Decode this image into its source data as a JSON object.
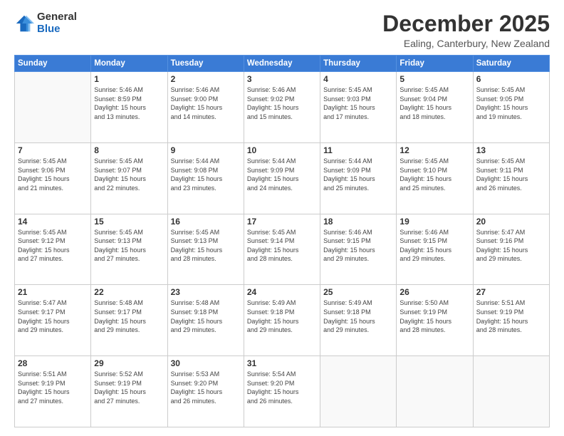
{
  "logo": {
    "general": "General",
    "blue": "Blue"
  },
  "header": {
    "month": "December 2025",
    "location": "Ealing, Canterbury, New Zealand"
  },
  "weekdays": [
    "Sunday",
    "Monday",
    "Tuesday",
    "Wednesday",
    "Thursday",
    "Friday",
    "Saturday"
  ],
  "weeks": [
    [
      {
        "day": "",
        "info": ""
      },
      {
        "day": "1",
        "info": "Sunrise: 5:46 AM\nSunset: 8:59 PM\nDaylight: 15 hours\nand 13 minutes."
      },
      {
        "day": "2",
        "info": "Sunrise: 5:46 AM\nSunset: 9:00 PM\nDaylight: 15 hours\nand 14 minutes."
      },
      {
        "day": "3",
        "info": "Sunrise: 5:46 AM\nSunset: 9:02 PM\nDaylight: 15 hours\nand 15 minutes."
      },
      {
        "day": "4",
        "info": "Sunrise: 5:45 AM\nSunset: 9:03 PM\nDaylight: 15 hours\nand 17 minutes."
      },
      {
        "day": "5",
        "info": "Sunrise: 5:45 AM\nSunset: 9:04 PM\nDaylight: 15 hours\nand 18 minutes."
      },
      {
        "day": "6",
        "info": "Sunrise: 5:45 AM\nSunset: 9:05 PM\nDaylight: 15 hours\nand 19 minutes."
      }
    ],
    [
      {
        "day": "7",
        "info": "Sunrise: 5:45 AM\nSunset: 9:06 PM\nDaylight: 15 hours\nand 21 minutes."
      },
      {
        "day": "8",
        "info": "Sunrise: 5:45 AM\nSunset: 9:07 PM\nDaylight: 15 hours\nand 22 minutes."
      },
      {
        "day": "9",
        "info": "Sunrise: 5:44 AM\nSunset: 9:08 PM\nDaylight: 15 hours\nand 23 minutes."
      },
      {
        "day": "10",
        "info": "Sunrise: 5:44 AM\nSunset: 9:09 PM\nDaylight: 15 hours\nand 24 minutes."
      },
      {
        "day": "11",
        "info": "Sunrise: 5:44 AM\nSunset: 9:09 PM\nDaylight: 15 hours\nand 25 minutes."
      },
      {
        "day": "12",
        "info": "Sunrise: 5:45 AM\nSunset: 9:10 PM\nDaylight: 15 hours\nand 25 minutes."
      },
      {
        "day": "13",
        "info": "Sunrise: 5:45 AM\nSunset: 9:11 PM\nDaylight: 15 hours\nand 26 minutes."
      }
    ],
    [
      {
        "day": "14",
        "info": "Sunrise: 5:45 AM\nSunset: 9:12 PM\nDaylight: 15 hours\nand 27 minutes."
      },
      {
        "day": "15",
        "info": "Sunrise: 5:45 AM\nSunset: 9:13 PM\nDaylight: 15 hours\nand 27 minutes."
      },
      {
        "day": "16",
        "info": "Sunrise: 5:45 AM\nSunset: 9:13 PM\nDaylight: 15 hours\nand 28 minutes."
      },
      {
        "day": "17",
        "info": "Sunrise: 5:45 AM\nSunset: 9:14 PM\nDaylight: 15 hours\nand 28 minutes."
      },
      {
        "day": "18",
        "info": "Sunrise: 5:46 AM\nSunset: 9:15 PM\nDaylight: 15 hours\nand 29 minutes."
      },
      {
        "day": "19",
        "info": "Sunrise: 5:46 AM\nSunset: 9:15 PM\nDaylight: 15 hours\nand 29 minutes."
      },
      {
        "day": "20",
        "info": "Sunrise: 5:47 AM\nSunset: 9:16 PM\nDaylight: 15 hours\nand 29 minutes."
      }
    ],
    [
      {
        "day": "21",
        "info": "Sunrise: 5:47 AM\nSunset: 9:17 PM\nDaylight: 15 hours\nand 29 minutes."
      },
      {
        "day": "22",
        "info": "Sunrise: 5:48 AM\nSunset: 9:17 PM\nDaylight: 15 hours\nand 29 minutes."
      },
      {
        "day": "23",
        "info": "Sunrise: 5:48 AM\nSunset: 9:18 PM\nDaylight: 15 hours\nand 29 minutes."
      },
      {
        "day": "24",
        "info": "Sunrise: 5:49 AM\nSunset: 9:18 PM\nDaylight: 15 hours\nand 29 minutes."
      },
      {
        "day": "25",
        "info": "Sunrise: 5:49 AM\nSunset: 9:18 PM\nDaylight: 15 hours\nand 29 minutes."
      },
      {
        "day": "26",
        "info": "Sunrise: 5:50 AM\nSunset: 9:19 PM\nDaylight: 15 hours\nand 28 minutes."
      },
      {
        "day": "27",
        "info": "Sunrise: 5:51 AM\nSunset: 9:19 PM\nDaylight: 15 hours\nand 28 minutes."
      }
    ],
    [
      {
        "day": "28",
        "info": "Sunrise: 5:51 AM\nSunset: 9:19 PM\nDaylight: 15 hours\nand 27 minutes."
      },
      {
        "day": "29",
        "info": "Sunrise: 5:52 AM\nSunset: 9:19 PM\nDaylight: 15 hours\nand 27 minutes."
      },
      {
        "day": "30",
        "info": "Sunrise: 5:53 AM\nSunset: 9:20 PM\nDaylight: 15 hours\nand 26 minutes."
      },
      {
        "day": "31",
        "info": "Sunrise: 5:54 AM\nSunset: 9:20 PM\nDaylight: 15 hours\nand 26 minutes."
      },
      {
        "day": "",
        "info": ""
      },
      {
        "day": "",
        "info": ""
      },
      {
        "day": "",
        "info": ""
      }
    ]
  ]
}
